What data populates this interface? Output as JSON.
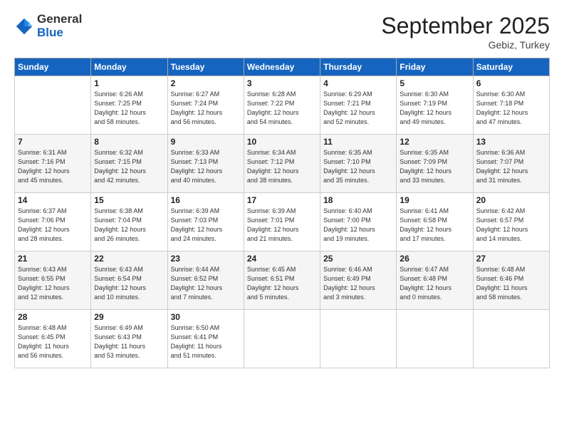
{
  "logo": {
    "general": "General",
    "blue": "Blue"
  },
  "header": {
    "month": "September 2025",
    "location": "Gebiz, Turkey"
  },
  "days_of_week": [
    "Sunday",
    "Monday",
    "Tuesday",
    "Wednesday",
    "Thursday",
    "Friday",
    "Saturday"
  ],
  "weeks": [
    [
      {
        "day": "",
        "info": ""
      },
      {
        "day": "1",
        "info": "Sunrise: 6:26 AM\nSunset: 7:25 PM\nDaylight: 12 hours\nand 58 minutes."
      },
      {
        "day": "2",
        "info": "Sunrise: 6:27 AM\nSunset: 7:24 PM\nDaylight: 12 hours\nand 56 minutes."
      },
      {
        "day": "3",
        "info": "Sunrise: 6:28 AM\nSunset: 7:22 PM\nDaylight: 12 hours\nand 54 minutes."
      },
      {
        "day": "4",
        "info": "Sunrise: 6:29 AM\nSunset: 7:21 PM\nDaylight: 12 hours\nand 52 minutes."
      },
      {
        "day": "5",
        "info": "Sunrise: 6:30 AM\nSunset: 7:19 PM\nDaylight: 12 hours\nand 49 minutes."
      },
      {
        "day": "6",
        "info": "Sunrise: 6:30 AM\nSunset: 7:18 PM\nDaylight: 12 hours\nand 47 minutes."
      }
    ],
    [
      {
        "day": "7",
        "info": "Sunrise: 6:31 AM\nSunset: 7:16 PM\nDaylight: 12 hours\nand 45 minutes."
      },
      {
        "day": "8",
        "info": "Sunrise: 6:32 AM\nSunset: 7:15 PM\nDaylight: 12 hours\nand 42 minutes."
      },
      {
        "day": "9",
        "info": "Sunrise: 6:33 AM\nSunset: 7:13 PM\nDaylight: 12 hours\nand 40 minutes."
      },
      {
        "day": "10",
        "info": "Sunrise: 6:34 AM\nSunset: 7:12 PM\nDaylight: 12 hours\nand 38 minutes."
      },
      {
        "day": "11",
        "info": "Sunrise: 6:35 AM\nSunset: 7:10 PM\nDaylight: 12 hours\nand 35 minutes."
      },
      {
        "day": "12",
        "info": "Sunrise: 6:35 AM\nSunset: 7:09 PM\nDaylight: 12 hours\nand 33 minutes."
      },
      {
        "day": "13",
        "info": "Sunrise: 6:36 AM\nSunset: 7:07 PM\nDaylight: 12 hours\nand 31 minutes."
      }
    ],
    [
      {
        "day": "14",
        "info": "Sunrise: 6:37 AM\nSunset: 7:06 PM\nDaylight: 12 hours\nand 28 minutes."
      },
      {
        "day": "15",
        "info": "Sunrise: 6:38 AM\nSunset: 7:04 PM\nDaylight: 12 hours\nand 26 minutes."
      },
      {
        "day": "16",
        "info": "Sunrise: 6:39 AM\nSunset: 7:03 PM\nDaylight: 12 hours\nand 24 minutes."
      },
      {
        "day": "17",
        "info": "Sunrise: 6:39 AM\nSunset: 7:01 PM\nDaylight: 12 hours\nand 21 minutes."
      },
      {
        "day": "18",
        "info": "Sunrise: 6:40 AM\nSunset: 7:00 PM\nDaylight: 12 hours\nand 19 minutes."
      },
      {
        "day": "19",
        "info": "Sunrise: 6:41 AM\nSunset: 6:58 PM\nDaylight: 12 hours\nand 17 minutes."
      },
      {
        "day": "20",
        "info": "Sunrise: 6:42 AM\nSunset: 6:57 PM\nDaylight: 12 hours\nand 14 minutes."
      }
    ],
    [
      {
        "day": "21",
        "info": "Sunrise: 6:43 AM\nSunset: 6:55 PM\nDaylight: 12 hours\nand 12 minutes."
      },
      {
        "day": "22",
        "info": "Sunrise: 6:43 AM\nSunset: 6:54 PM\nDaylight: 12 hours\nand 10 minutes."
      },
      {
        "day": "23",
        "info": "Sunrise: 6:44 AM\nSunset: 6:52 PM\nDaylight: 12 hours\nand 7 minutes."
      },
      {
        "day": "24",
        "info": "Sunrise: 6:45 AM\nSunset: 6:51 PM\nDaylight: 12 hours\nand 5 minutes."
      },
      {
        "day": "25",
        "info": "Sunrise: 6:46 AM\nSunset: 6:49 PM\nDaylight: 12 hours\nand 3 minutes."
      },
      {
        "day": "26",
        "info": "Sunrise: 6:47 AM\nSunset: 6:48 PM\nDaylight: 12 hours\nand 0 minutes."
      },
      {
        "day": "27",
        "info": "Sunrise: 6:48 AM\nSunset: 6:46 PM\nDaylight: 11 hours\nand 58 minutes."
      }
    ],
    [
      {
        "day": "28",
        "info": "Sunrise: 6:48 AM\nSunset: 6:45 PM\nDaylight: 11 hours\nand 56 minutes."
      },
      {
        "day": "29",
        "info": "Sunrise: 6:49 AM\nSunset: 6:43 PM\nDaylight: 11 hours\nand 53 minutes."
      },
      {
        "day": "30",
        "info": "Sunrise: 6:50 AM\nSunset: 6:41 PM\nDaylight: 11 hours\nand 51 minutes."
      },
      {
        "day": "",
        "info": ""
      },
      {
        "day": "",
        "info": ""
      },
      {
        "day": "",
        "info": ""
      },
      {
        "day": "",
        "info": ""
      }
    ]
  ]
}
